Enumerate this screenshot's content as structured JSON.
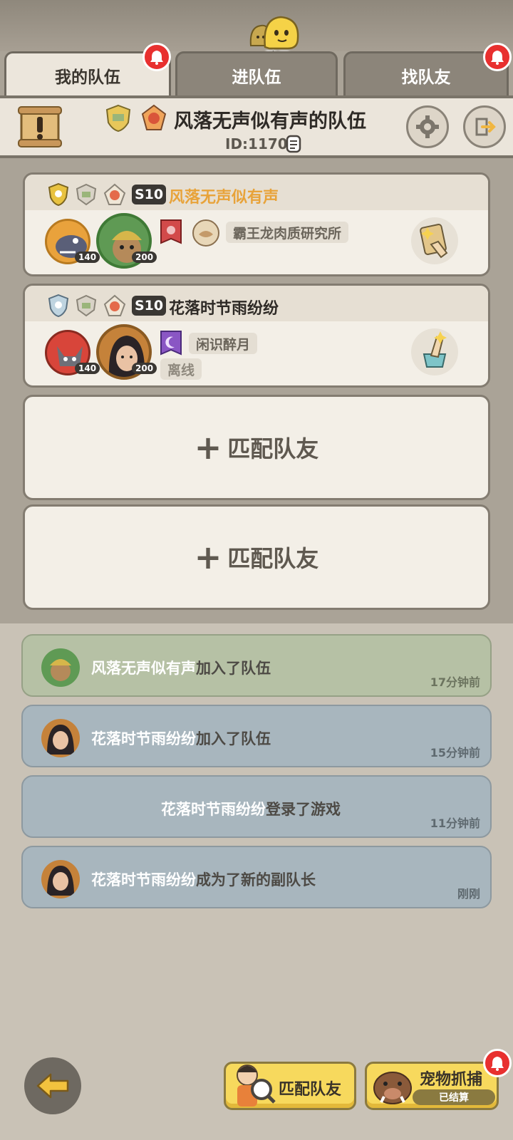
{
  "chat": {
    "label": "聊天"
  },
  "tabs": [
    {
      "label": "我的队伍",
      "active": true,
      "has_alert": true
    },
    {
      "label": "进队伍",
      "active": false,
      "has_alert": false
    },
    {
      "label": "找队友",
      "active": false,
      "has_alert": true
    }
  ],
  "team": {
    "name": "风落无声似有声的队伍",
    "id": "ID:11700"
  },
  "members": [
    {
      "season": "S10",
      "name": "风落无声似有声",
      "name_color": "#e8a33a",
      "pet_level": "140",
      "avatar_level": "200",
      "tag": "霸王龙肉质研究所",
      "status": ""
    },
    {
      "season": "S10",
      "name": "花落时节雨纷纷",
      "name_color": "#2e2a26",
      "pet_level": "140",
      "avatar_level": "200",
      "tag": "闲识醉月",
      "status": "离线"
    }
  ],
  "add_slots": [
    {
      "label": "匹配队友"
    },
    {
      "label": "匹配队友"
    }
  ],
  "feed": [
    {
      "who": "风落无声似有声",
      "action": "加入了队伍",
      "time": "17分钟前",
      "style": "green",
      "has_avatar": true
    },
    {
      "who": "花落时节雨纷纷",
      "action": "加入了队伍",
      "time": "15分钟前",
      "style": "blue",
      "has_avatar": true
    },
    {
      "who": "花落时节雨纷纷",
      "action": "登录了游戏",
      "time": "11分钟前",
      "style": "blue",
      "has_avatar": false
    },
    {
      "who": "花落时节雨纷纷",
      "action": "成为了新的副队长",
      "time": "刚刚",
      "style": "blue",
      "has_avatar": true
    }
  ],
  "bottom": {
    "match_label": "匹配队友",
    "pet_label": "宠物抓捕",
    "pet_status": "已结算"
  }
}
